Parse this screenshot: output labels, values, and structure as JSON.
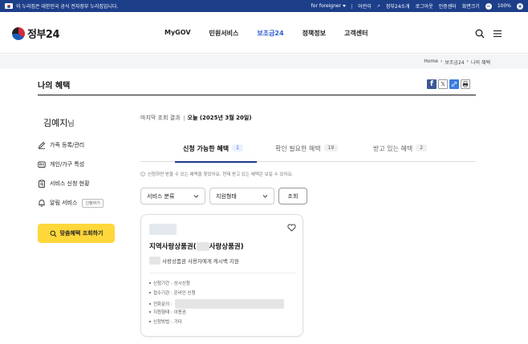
{
  "colors": {
    "banner": "#1d3f8a",
    "accent": "#2a5cd0",
    "cta": "#fed73b",
    "crumb_bg": "#f4f5f7"
  },
  "banner": {
    "notice": "이 누리집은 대한민국 공식 전자정부 누리집입니다.",
    "links": [
      "for foreigner",
      "어린이",
      "정부24소개",
      "로그아웃",
      "인증센터",
      "화면크기"
    ],
    "zoom": "100%"
  },
  "header": {
    "logo": "정부24",
    "nav": [
      "MyGOV",
      "민원서비스",
      "보조금24",
      "정책정보",
      "고객센터"
    ],
    "active_nav": "보조금24",
    "icons": [
      "search-icon",
      "menu-icon"
    ]
  },
  "breadcrumb": [
    "Home",
    "보조금24",
    "나의 혜택"
  ],
  "page": {
    "title": "나의 혜택",
    "share_icons": [
      "facebook-icon",
      "x-icon",
      "link-icon",
      "print-icon"
    ]
  },
  "sidebar": {
    "user_name": "김예지",
    "user_suffix": "님",
    "items": [
      {
        "label": "가족 등록/관리",
        "icon": "pencil-icon"
      },
      {
        "label": "개인/가구 특성",
        "icon": "id-card-icon"
      },
      {
        "label": "서비스 신청 현황",
        "icon": "clipboard-icon"
      },
      {
        "label": "알림 서비스",
        "icon": "bell-icon",
        "badge": "신청하기"
      }
    ],
    "cta": "맞춤혜택 조회하기"
  },
  "main": {
    "last_query_label": "마지막 조회 결과",
    "last_query_date": "오늘 (2025년 3월 20일)",
    "tabs": [
      {
        "label": "신청 가능한 혜택",
        "count": "1"
      },
      {
        "label": "확인 필요한 혜택",
        "count": "19"
      },
      {
        "label": "받고 있는 혜택",
        "count": "2"
      }
    ],
    "notice": "신청하면 받을 수 있는 혜택을 찾았어요. 현재 받고 있는 혜택은 보일 수 있어요.",
    "filters": {
      "category": "서비스 분류",
      "type": "지원형태",
      "search_label": "조회"
    },
    "card": {
      "title_prefix": "지역사랑상품권(",
      "title_suffix": "사랑상품권)",
      "description": "사랑상품권 사용자에게 캐시백 지원",
      "details": [
        "신청기간 : 상시신청",
        "접수기관 : 온라인 신청",
        "전화문의 :",
        "지원형태 : 이용권",
        "신청방법 : 기타"
      ]
    }
  }
}
